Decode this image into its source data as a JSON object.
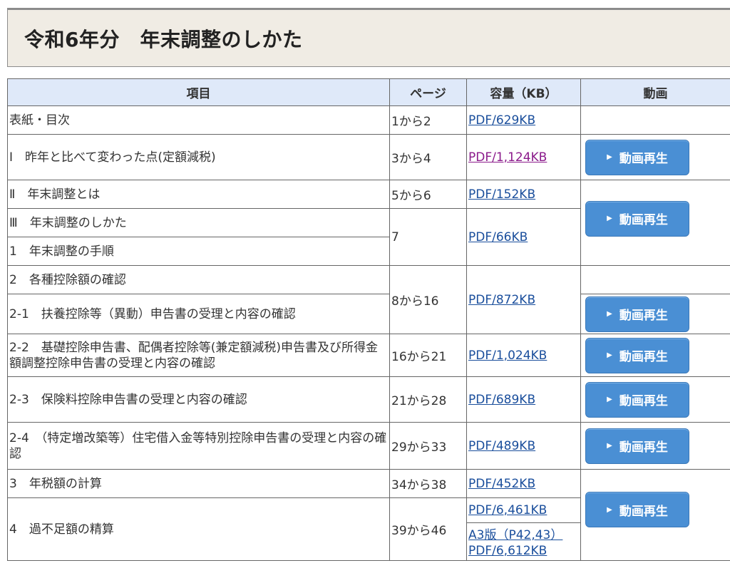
{
  "page_title": "令和6年分　年末調整のしかた",
  "table": {
    "headers": [
      "項目",
      "ページ",
      "容量（KB）",
      "動画"
    ],
    "video_button_label": "動画再生",
    "rows": {
      "r1": {
        "item": "表紙・目次",
        "page": "1から2",
        "pdf": "PDF/629KB"
      },
      "r2": {
        "item": "Ⅰ　昨年と比べて変わった点(定額減税)",
        "page": "3から4",
        "pdf": "PDF/1,124KB"
      },
      "r3": {
        "item": "Ⅱ　年末調整とは",
        "page": "5から6",
        "pdf": "PDF/152KB"
      },
      "r4": {
        "item": "Ⅲ　年末調整のしかた",
        "page": "7",
        "pdf": "PDF/66KB"
      },
      "r5": {
        "item": "1　年末調整の手順"
      },
      "r6": {
        "item": "2　各種控除額の確認",
        "page": "8から16",
        "pdf": "PDF/872KB"
      },
      "r7": {
        "item": "2-1　扶養控除等（異動）申告書の受理と内容の確認"
      },
      "r8": {
        "item": "2-2　基礎控除申告書、配偶者控除等(兼定額減税)申告書及び所得金額調整控除申告書の受理と内容の確認",
        "page": "16から21",
        "pdf": "PDF/1,024KB"
      },
      "r9": {
        "item": "2-3　保険料控除申告書の受理と内容の確認",
        "page": "21から28",
        "pdf": "PDF/689KB"
      },
      "r10": {
        "item": "2-4　（特定増改築等）住宅借入金等特別控除申告書の受理と内容の確認",
        "page": "29から33",
        "pdf": "PDF/489KB"
      },
      "r11": {
        "item": "3　年税額の計算",
        "page": "34から38",
        "pdf": "PDF/452KB"
      },
      "r12": {
        "item": "4　過不足額の精算",
        "page": "39から46",
        "pdf": "PDF/6,461KB",
        "pdf2": "A3版（P42,43）PDF/6,612KB"
      }
    }
  }
}
